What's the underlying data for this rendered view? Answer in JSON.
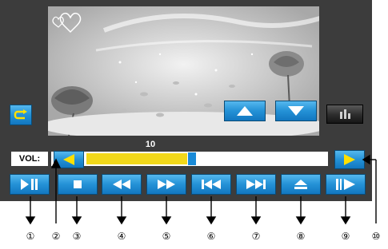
{
  "volume": {
    "label": "VOL:",
    "value": "10",
    "level_fraction": 0.44
  },
  "callouts": [
    "①",
    "②",
    "③",
    "④",
    "⑤",
    "⑥",
    "⑦",
    "⑧",
    "⑨",
    "⑩"
  ],
  "icons": {
    "repeat": "repeat-icon",
    "up": "arrow-up-icon",
    "down": "arrow-down-icon",
    "eq": "equalizer-icon",
    "vol_down": "volume-down-icon",
    "vol_up": "volume-up-icon",
    "play_pause": "play-pause-icon",
    "stop": "stop-icon",
    "rewind": "rewind-icon",
    "fast_forward": "fast-forward-icon",
    "prev": "previous-track-icon",
    "next": "next-track-icon",
    "eject": "eject-icon",
    "slow_step": "step-play-icon"
  },
  "colors": {
    "panel": "#3c3c3c",
    "button": "#2491d6",
    "volume_fill": "#f2d81a",
    "icon": "#ffffff"
  }
}
